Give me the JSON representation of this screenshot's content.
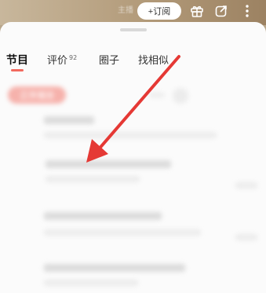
{
  "header": {
    "faded_text": "主播",
    "subscribe_label": "+订阅",
    "icons": [
      "gift-icon",
      "share-icon",
      "more-icon"
    ]
  },
  "tabs": [
    {
      "label": "节目",
      "active": true
    },
    {
      "label": "评价",
      "badge": "92"
    },
    {
      "label": "圈子"
    },
    {
      "label": "找相似"
    }
  ],
  "filter_chip": {
    "label": "正序播放"
  },
  "colors": {
    "accent": "#f26a5e",
    "arrow": "#e53935",
    "header_bg": "#b29a79"
  }
}
